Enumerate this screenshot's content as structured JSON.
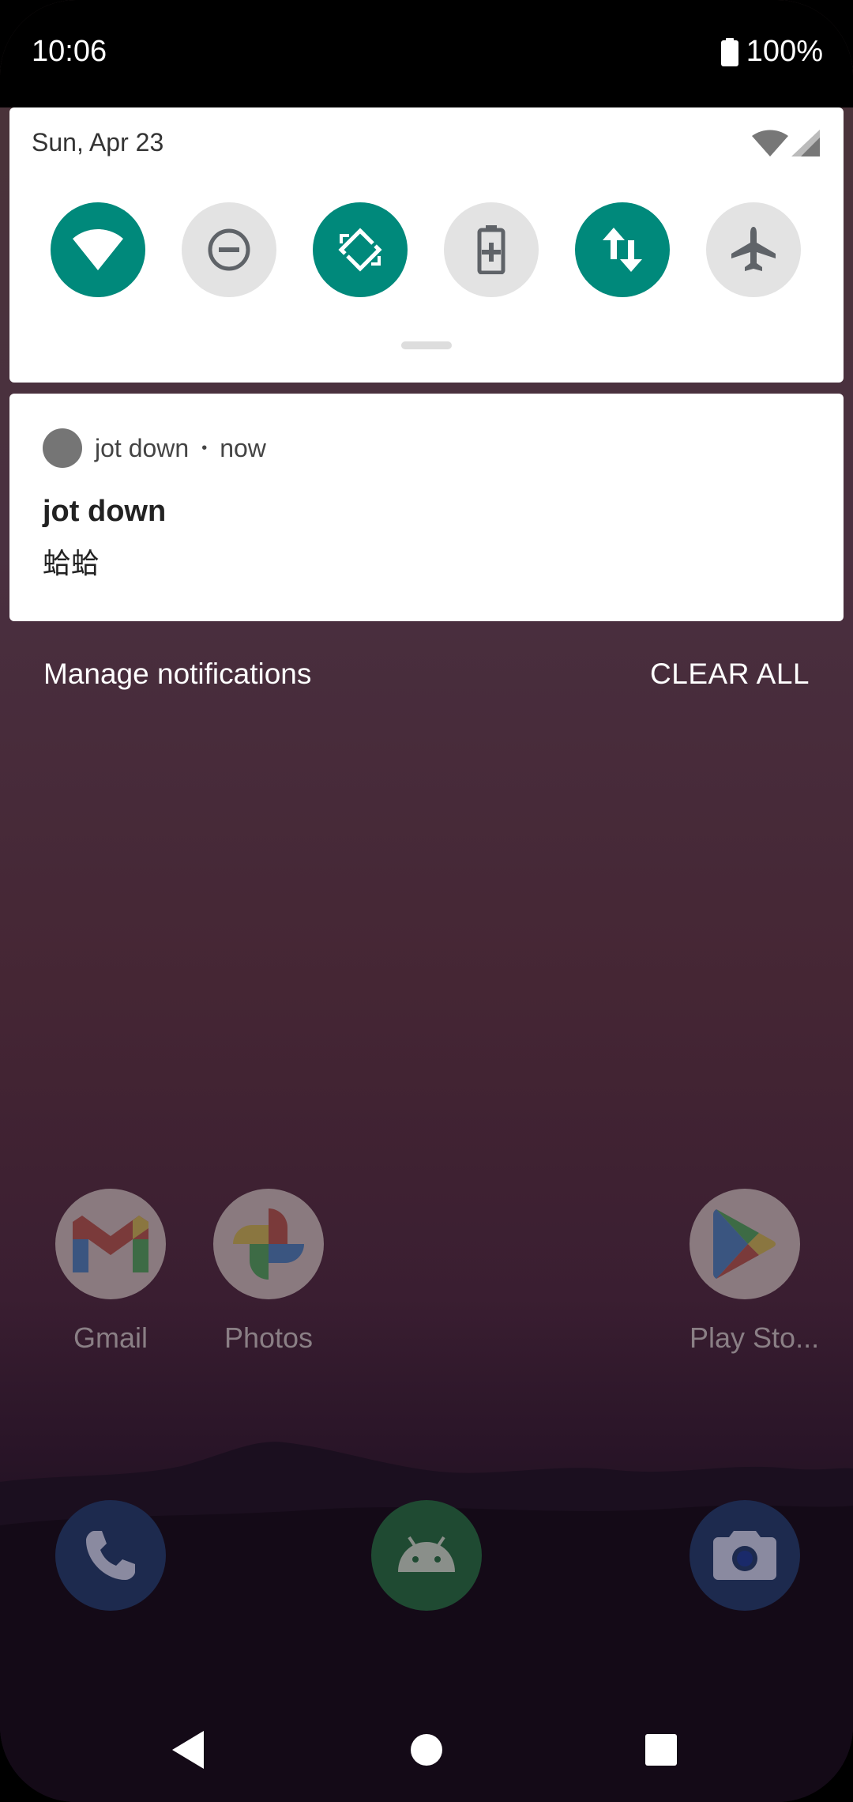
{
  "status_bar": {
    "time": "10:06",
    "battery": "100%"
  },
  "quick_settings": {
    "date": "Sun, Apr 23",
    "tiles": [
      {
        "name": "wifi",
        "icon": "wifi-icon",
        "active": true
      },
      {
        "name": "do-not-disturb",
        "icon": "dnd-icon",
        "active": false
      },
      {
        "name": "auto-rotate",
        "icon": "rotate-icon",
        "active": true
      },
      {
        "name": "battery-saver",
        "icon": "battery-saver-icon",
        "active": false
      },
      {
        "name": "mobile-data",
        "icon": "data-arrows-icon",
        "active": true
      },
      {
        "name": "airplane-mode",
        "icon": "airplane-icon",
        "active": false
      }
    ],
    "accent": "#00897b"
  },
  "notification": {
    "app_name": "jot down",
    "time": "now",
    "title": "jot down",
    "text": "蛤蛤"
  },
  "actions": {
    "manage": "Manage notifications",
    "clear_all": "CLEAR ALL"
  },
  "home_apps": [
    {
      "label": "Gmail",
      "icon": "gmail-icon"
    },
    {
      "label": "Photos",
      "icon": "photos-icon"
    },
    {
      "label": "Play Sto...",
      "icon": "play-store-icon"
    }
  ],
  "dock": [
    {
      "name": "phone",
      "icon": "phone-icon"
    },
    {
      "name": "android",
      "icon": "android-icon"
    },
    {
      "name": "camera",
      "icon": "camera-icon"
    }
  ],
  "nav": {
    "back": "back-icon",
    "home": "home-icon",
    "recents": "recents-icon"
  }
}
